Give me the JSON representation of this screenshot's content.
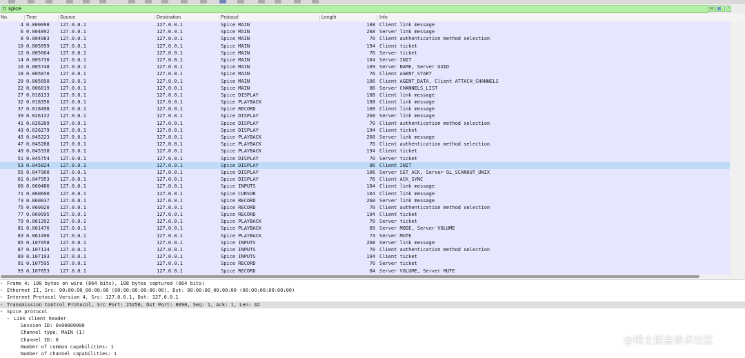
{
  "filter": {
    "value": "spice",
    "clear_glyph": "×",
    "apply_glyph": "",
    "dropdown_glyph": "▾"
  },
  "columns": {
    "no": "No.",
    "time": "Time",
    "source": "Source",
    "destination": "Destination",
    "protocol": "Protocol",
    "length": "Length",
    "info": "Info"
  },
  "selected_packet": "53",
  "packets": [
    {
      "no": "4",
      "time": "0.000098",
      "src": "127.0.0.1",
      "dst": "127.0.0.1",
      "proto": "Spice MAIN",
      "len": "108",
      "info": "Client link message"
    },
    {
      "no": "6",
      "time": "0.004892",
      "src": "127.0.0.1",
      "dst": "127.0.0.1",
      "proto": "Spice MAIN",
      "len": "268",
      "info": "Server link message"
    },
    {
      "no": "8",
      "time": "0.004983",
      "src": "127.0.0.1",
      "dst": "127.0.0.1",
      "proto": "Spice MAIN",
      "len": "70",
      "info": "Client authentication method selection"
    },
    {
      "no": "10",
      "time": "0.005099",
      "src": "127.0.0.1",
      "dst": "127.0.0.1",
      "proto": "Spice MAIN",
      "len": "194",
      "info": "Client ticket"
    },
    {
      "no": "12",
      "time": "0.005664",
      "src": "127.0.0.1",
      "dst": "127.0.0.1",
      "proto": "Spice MAIN",
      "len": "70",
      "info": "Server ticket"
    },
    {
      "no": "14",
      "time": "0.005730",
      "src": "127.0.0.1",
      "dst": "127.0.0.1",
      "proto": "Spice MAIN",
      "len": "104",
      "info": "Server INIT"
    },
    {
      "no": "16",
      "time": "0.005748",
      "src": "127.0.0.1",
      "dst": "127.0.0.1",
      "proto": "Spice MAIN",
      "len": "109",
      "info": "Server NAME, Server UUID"
    },
    {
      "no": "18",
      "time": "0.005870",
      "src": "127.0.0.1",
      "dst": "127.0.0.1",
      "proto": "Spice MAIN",
      "len": "76",
      "info": "Client AGENT_START"
    },
    {
      "no": "20",
      "time": "0.005890",
      "src": "127.0.0.1",
      "dst": "127.0.0.1",
      "proto": "Spice MAIN",
      "len": "106",
      "info": "Client AGENT_DATA, Client ATTACH_CHANNELS"
    },
    {
      "no": "22",
      "time": "0.006019",
      "src": "127.0.0.1",
      "dst": "127.0.0.1",
      "proto": "Spice MAIN",
      "len": "86",
      "info": "Server CHANNELS_LIST"
    },
    {
      "no": "27",
      "time": "0.018133",
      "src": "127.0.0.1",
      "dst": "127.0.0.1",
      "proto": "Spice DISPLAY",
      "len": "108",
      "info": "Client link message"
    },
    {
      "no": "32",
      "time": "0.018356",
      "src": "127.0.0.1",
      "dst": "127.0.0.1",
      "proto": "Spice PLAYBACK",
      "len": "108",
      "info": "Client link message"
    },
    {
      "no": "37",
      "time": "0.018498",
      "src": "127.0.0.1",
      "dst": "127.0.0.1",
      "proto": "Spice RECORD",
      "len": "108",
      "info": "Client link message"
    },
    {
      "no": "39",
      "time": "0.026132",
      "src": "127.0.0.1",
      "dst": "127.0.0.1",
      "proto": "Spice DISPLAY",
      "len": "268",
      "info": "Server link message"
    },
    {
      "no": "41",
      "time": "0.026209",
      "src": "127.0.0.1",
      "dst": "127.0.0.1",
      "proto": "Spice DISPLAY",
      "len": "70",
      "info": "Client authentication method selection"
    },
    {
      "no": "43",
      "time": "0.026279",
      "src": "127.0.0.1",
      "dst": "127.0.0.1",
      "proto": "Spice DISPLAY",
      "len": "194",
      "info": "Client ticket"
    },
    {
      "no": "45",
      "time": "0.045223",
      "src": "127.0.0.1",
      "dst": "127.0.0.1",
      "proto": "Spice PLAYBACK",
      "len": "268",
      "info": "Server link message"
    },
    {
      "no": "47",
      "time": "0.045288",
      "src": "127.0.0.1",
      "dst": "127.0.0.1",
      "proto": "Spice PLAYBACK",
      "len": "70",
      "info": "Client authentication method selection"
    },
    {
      "no": "49",
      "time": "0.045338",
      "src": "127.0.0.1",
      "dst": "127.0.0.1",
      "proto": "Spice PLAYBACK",
      "len": "194",
      "info": "Client ticket"
    },
    {
      "no": "51",
      "time": "0.045754",
      "src": "127.0.0.1",
      "dst": "127.0.0.1",
      "proto": "Spice DISPLAY",
      "len": "70",
      "info": "Server ticket"
    },
    {
      "no": "53",
      "time": "0.045824",
      "src": "127.0.0.1",
      "dst": "127.0.0.1",
      "proto": "Spice DISPLAY",
      "len": "86",
      "info": "Client INIT"
    },
    {
      "no": "55",
      "time": "0.047900",
      "src": "127.0.0.1",
      "dst": "127.0.0.1",
      "proto": "Spice DISPLAY",
      "len": "106",
      "info": "Server SET_ACK, Server GL_SCANOUT_UNIX"
    },
    {
      "no": "61",
      "time": "0.047953",
      "src": "127.0.0.1",
      "dst": "127.0.0.1",
      "proto": "Spice DISPLAY",
      "len": "76",
      "info": "Client ACK_SYNC"
    },
    {
      "no": "66",
      "time": "0.060486",
      "src": "127.0.0.1",
      "dst": "127.0.0.1",
      "proto": "Spice INPUTS",
      "len": "104",
      "info": "Client link message"
    },
    {
      "no": "71",
      "time": "0.060600",
      "src": "127.0.0.1",
      "dst": "127.0.0.1",
      "proto": "Spice CURSOR",
      "len": "104",
      "info": "Client link message"
    },
    {
      "no": "73",
      "time": "0.060837",
      "src": "127.0.0.1",
      "dst": "127.0.0.1",
      "proto": "Spice RECORD",
      "len": "268",
      "info": "Server link message"
    },
    {
      "no": "75",
      "time": "0.060920",
      "src": "127.0.0.1",
      "dst": "127.0.0.1",
      "proto": "Spice RECORD",
      "len": "70",
      "info": "Client authentication method selection"
    },
    {
      "no": "77",
      "time": "0.060995",
      "src": "127.0.0.1",
      "dst": "127.0.0.1",
      "proto": "Spice RECORD",
      "len": "194",
      "info": "Client ticket"
    },
    {
      "no": "79",
      "time": "0.061392",
      "src": "127.0.0.1",
      "dst": "127.0.0.1",
      "proto": "Spice PLAYBACK",
      "len": "70",
      "info": "Server ticket"
    },
    {
      "no": "81",
      "time": "0.061476",
      "src": "127.0.0.1",
      "dst": "127.0.0.1",
      "proto": "Spice PLAYBACK",
      "len": "89",
      "info": "Server MODE, Server VOLUME"
    },
    {
      "no": "83",
      "time": "0.061496",
      "src": "127.0.0.1",
      "dst": "127.0.0.1",
      "proto": "Spice PLAYBACK",
      "len": "73",
      "info": "Server MUTE"
    },
    {
      "no": "85",
      "time": "0.107058",
      "src": "127.0.0.1",
      "dst": "127.0.0.1",
      "proto": "Spice INPUTS",
      "len": "268",
      "info": "Server link message"
    },
    {
      "no": "87",
      "time": "0.107134",
      "src": "127.0.0.1",
      "dst": "127.0.0.1",
      "proto": "Spice INPUTS",
      "len": "70",
      "info": "Client authentication method selection"
    },
    {
      "no": "89",
      "time": "0.107193",
      "src": "127.0.0.1",
      "dst": "127.0.0.1",
      "proto": "Spice INPUTS",
      "len": "194",
      "info": "Client ticket"
    },
    {
      "no": "91",
      "time": "0.107595",
      "src": "127.0.0.1",
      "dst": "127.0.0.1",
      "proto": "Spice RECORD",
      "len": "70",
      "info": "Server ticket"
    },
    {
      "no": "93",
      "time": "0.107653",
      "src": "127.0.0.1",
      "dst": "127.0.0.1",
      "proto": "Spice RECORD",
      "len": "84",
      "info": "Server VOLUME, Server MUTE"
    }
  ],
  "details": [
    {
      "text": "Frame 4: 108 bytes on wire (864 bits), 108 bytes captured (864 bits)",
      "arrow": "▸",
      "indent": 0,
      "highlight": false
    },
    {
      "text": "Ethernet II, Src: 00:00:00_00:00:00 (00:00:00:00:00:00), Dst: 00:00:00_00:00:00 (00:00:00:00:00:00)",
      "arrow": "▸",
      "indent": 0,
      "highlight": false
    },
    {
      "text": "Internet Protocol Version 4, Src: 127.0.0.1, Dst: 127.0.0.1",
      "arrow": "▸",
      "indent": 0,
      "highlight": false
    },
    {
      "text": "Transmission Control Protocol, Src Port: 25250, Dst Port: 8090, Seq: 1, Ack: 1, Len: 42",
      "arrow": "▸",
      "indent": 0,
      "highlight": true
    },
    {
      "text": "Spice protocol",
      "arrow": "▾",
      "indent": 0,
      "highlight": false
    },
    {
      "text": "Link client header",
      "arrow": "▸",
      "indent": 1,
      "highlight": false
    },
    {
      "text": "Session ID: 0x00000000",
      "arrow": "",
      "indent": 2,
      "highlight": false
    },
    {
      "text": "Channel type: MAIN (1)",
      "arrow": "",
      "indent": 2,
      "highlight": false
    },
    {
      "text": "Channel ID: 0",
      "arrow": "",
      "indent": 2,
      "highlight": false
    },
    {
      "text": "Number of common capabilities: 1",
      "arrow": "",
      "indent": 2,
      "highlight": false
    },
    {
      "text": "Number of channel capabilities: 1",
      "arrow": "",
      "indent": 2,
      "highlight": false
    }
  ],
  "watermark": "@稀土掘金技术社区",
  "colors": {
    "filter_valid": "#b3f1a6",
    "row_bg": "#e7e6ff",
    "row_selected": "#bedcf7",
    "details_highlight": "#dedede"
  }
}
